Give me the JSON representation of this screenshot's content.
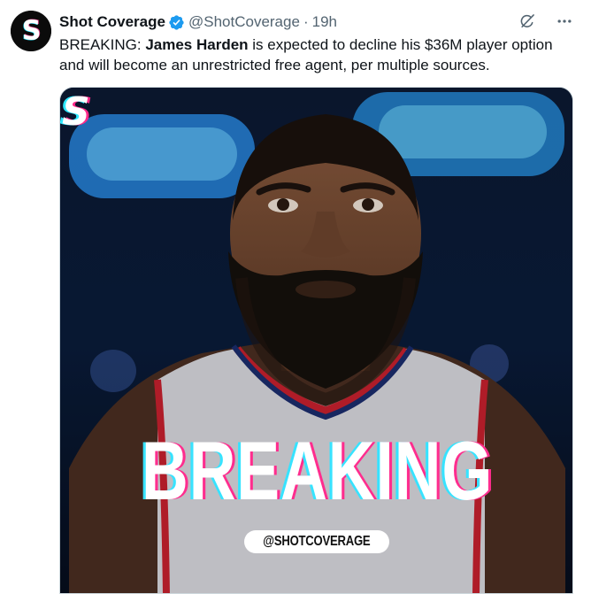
{
  "tweet": {
    "author_name": "Shot Coverage",
    "author_handle": "@ShotCoverage",
    "separator": "·",
    "time": "19h",
    "text_prefix": "BREAKING: ",
    "text_bold": "James Harden",
    "text_rest": " is expected to decline his $36M player option and will become an unrestricted free agent, per multiple sources.",
    "avatar_letter": "S",
    "verified_color": "#1d9bf0"
  },
  "media": {
    "logo_letter": "S",
    "headline": "BREAKING",
    "handle_tag": "@SHOTCOVERAGE",
    "accent_cyan": "#37e3ff",
    "accent_pink": "#ff2d8e"
  },
  "icons": {
    "verified": "verified-badge-icon",
    "grok": "grok-icon",
    "more": "more-horizontal-icon"
  }
}
